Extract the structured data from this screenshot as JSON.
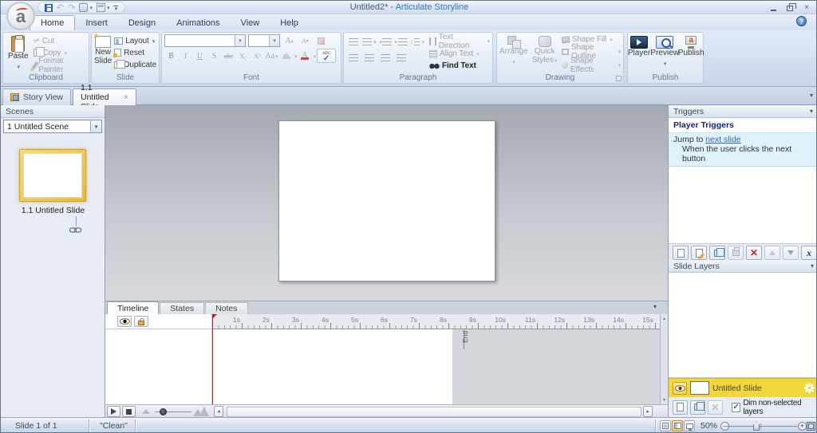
{
  "titlebar": {
    "document": "Untitled2*",
    "separator": "-",
    "app": "Articulate Storyline"
  },
  "ribbon_tabs": [
    {
      "label": "Home"
    },
    {
      "label": "Insert"
    },
    {
      "label": "Design"
    },
    {
      "label": "Animations"
    },
    {
      "label": "View"
    },
    {
      "label": "Help"
    }
  ],
  "clipboard": {
    "group_label": "Clipboard",
    "paste": "Paste",
    "cut": "Cut",
    "copy": "Copy",
    "format_painter": "Format Painter"
  },
  "slide_group": {
    "group_label": "Slide",
    "new_line1": "New",
    "new_line2": "Slide",
    "layout": "Layout",
    "reset": "Reset",
    "duplicate": "Duplicate"
  },
  "font_group": {
    "group_label": "Font",
    "bold": "B",
    "italic": "I",
    "underline": "U",
    "shadow": "S",
    "strikethrough": "abc",
    "subscript": "X₂",
    "superscript": "X²",
    "change_case": "Aa",
    "grow_font": "A",
    "shrink_font": "A",
    "spellcheck_text": "abc"
  },
  "paragraph_group": {
    "group_label": "Paragraph",
    "text_direction": "Text Direction",
    "align_text": "Align Text",
    "find_text": "Find Text"
  },
  "drawing_group": {
    "group_label": "Drawing",
    "arrange": "Arrange",
    "quick_styles_line1": "Quick",
    "quick_styles_line2": "Styles",
    "shape_fill": "Shape Fill",
    "shape_outline": "Shape Outline",
    "shape_effects": "Shape Effects"
  },
  "publish_group": {
    "group_label": "Publish",
    "player": "Player",
    "preview": "Preview",
    "publish": "Publish"
  },
  "view_tabs": {
    "story_view": "Story View",
    "slide_tab": "1.1 Untitled Slide"
  },
  "scenes_panel": {
    "header": "Scenes",
    "selected_scene": "1 Untitled Scene",
    "slide_thumb_label": "1.1 Untitled Slide"
  },
  "timeline_panel": {
    "tabs": [
      "Timeline",
      "States",
      "Notes"
    ],
    "ruler_ticks": [
      "1s",
      "2s",
      "3s",
      "4s",
      "5s",
      "6s",
      "7s",
      "8s",
      "9s",
      "10s",
      "11s",
      "12s",
      "13s",
      "14s",
      "15s"
    ],
    "end_marker": "End"
  },
  "triggers_panel": {
    "header": "Triggers",
    "section_title": "Player Triggers",
    "action_text": "Jump to",
    "action_link": "next slide",
    "condition_text": "When the user clicks the next button",
    "variables_glyph": "x"
  },
  "layers_panel": {
    "header": "Slide Layers",
    "base_layer_name": "Untitled Slide",
    "dim_label": "Dim non-selected layers"
  },
  "statusbar": {
    "slide_position": "Slide 1 of 1",
    "document_state": "\"Clean\"",
    "zoom_level": "50%"
  },
  "icons": {
    "caret_down": "▾",
    "close": "×",
    "minimize": "–",
    "help": "?",
    "cut": "✂",
    "undo": "↶",
    "redo": "↷"
  },
  "colors": {
    "accent_blue": "#2e77c4",
    "trigger_navy": "#16247e",
    "link_blue": "#3566b0",
    "selected_yellow": "#f3d63b",
    "thumb_gold": "#e9bc3a",
    "delete_red": "#c1272d",
    "playhead_red": "#c31f1f"
  }
}
